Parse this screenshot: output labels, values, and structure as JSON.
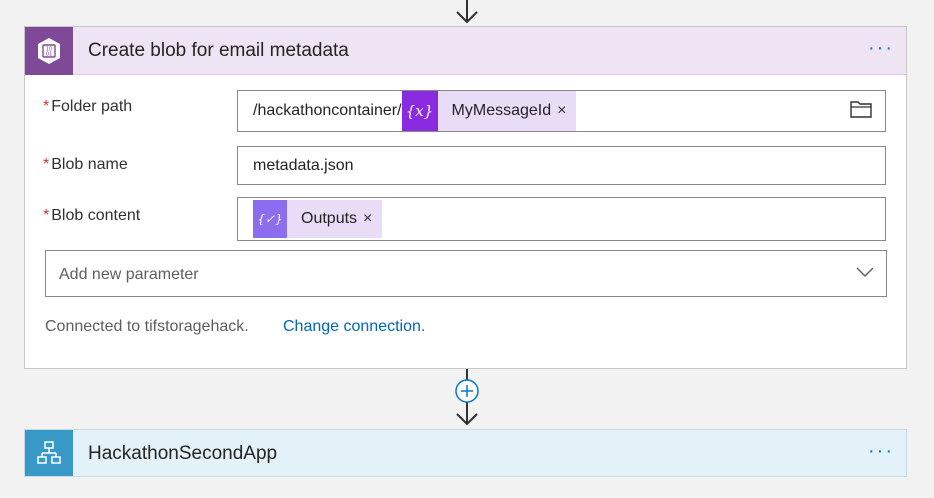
{
  "action": {
    "title": "Create blob for email metadata",
    "more_label": "···",
    "icon": "blob-storage-icon",
    "accent": "#804998",
    "header_bg": "#efe4f3",
    "required_mark": "*",
    "fields": {
      "folder_path": {
        "label": "Folder path",
        "prefix": "/hackathoncontainer/",
        "token_label": "MyMessageId",
        "token_icon": "variable-icon",
        "token_glyph": "{x}",
        "remove": "×",
        "picker_icon": "folder-icon"
      },
      "blob_name": {
        "label": "Blob name",
        "value": "metadata.json"
      },
      "blob_content": {
        "label": "Blob content",
        "token_label": "Outputs",
        "token_icon": "compose-icon",
        "token_glyph": "{✓}",
        "remove": "×"
      }
    },
    "add_parameter": {
      "placeholder": "Add new parameter",
      "icon": "chevron-down-icon"
    },
    "connection": {
      "text": "Connected to tifstoragehack.",
      "link": "Change connection."
    }
  },
  "connector": {
    "add_icon": "plus-circle-icon"
  },
  "next_action": {
    "title": "HackathonSecondApp",
    "more_label": "···",
    "icon": "workflow-icon",
    "accent": "#3999c6",
    "header_bg": "#e3f1f8"
  }
}
